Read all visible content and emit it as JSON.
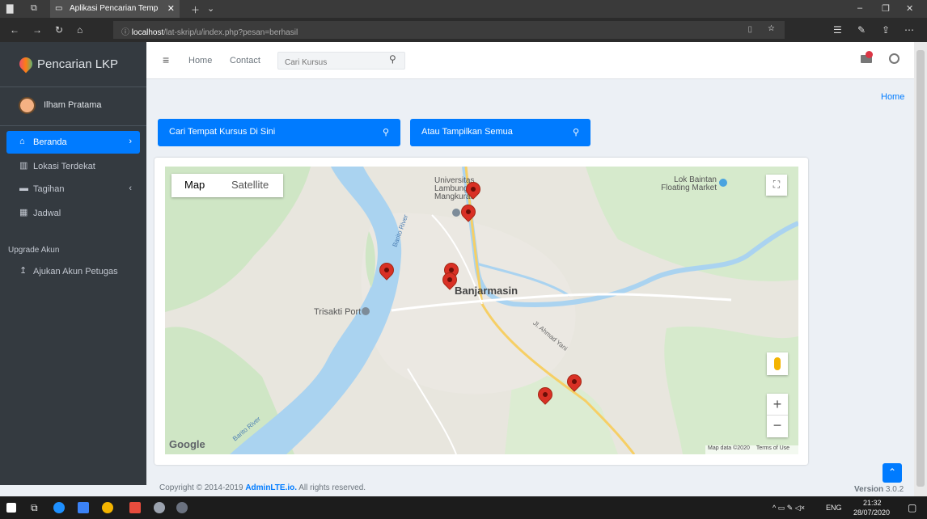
{
  "browser": {
    "tab_title": "Aplikasi Pencarian Temp",
    "url_host": "localhost",
    "url_path": "/lat-skrip/u/index.php?pesan=berhasil"
  },
  "sidebar": {
    "brand": "Pencarian LKP",
    "user_name": "Ilham Pratama",
    "items": [
      {
        "label": "Beranda",
        "icon": "home-icon",
        "active": true
      },
      {
        "label": "Lokasi Terdekat",
        "icon": "map-icon"
      },
      {
        "label": "Tagihan",
        "icon": "bill-icon"
      },
      {
        "label": "Jadwal",
        "icon": "calendar-icon"
      }
    ],
    "section_header": "Upgrade Akun",
    "extra_item": {
      "label": "Ajukan Akun Petugas",
      "icon": "upload-icon"
    }
  },
  "navbar": {
    "home": "Home",
    "contact": "Contact",
    "search_placeholder": "Cari Kursus"
  },
  "breadcrumb": "Home",
  "buttons": {
    "search_course": "Cari Tempat Kursus Di Sini",
    "show_all": "Atau Tampilkan Semua"
  },
  "map": {
    "type_map": "Map",
    "type_satellite": "Satellite",
    "city_label": "Banjarmasin",
    "labels": {
      "university": "Universitas Lambung Mangkurat",
      "floating_market": "Lok Baintan Floating Market",
      "port": "Trisakti Port",
      "river": "Barito River",
      "river2": "Barito River",
      "road": "Jl. Ahmad Yani"
    },
    "google": "Google",
    "attribution": "Map data ©2020",
    "terms": "Terms of Use",
    "marker_count": 7
  },
  "footer": {
    "copyright_prefix": "Copyright © 2014-2019 ",
    "brand": "AdminLTE.io.",
    "suffix": " All rights reserved.",
    "version_label": "Version",
    "version_number": "3.0.2"
  },
  "taskbar": {
    "lang": "ENG",
    "time": "21:32",
    "date": "28/07/2020"
  },
  "colors": {
    "primary": "#007bff",
    "sidebar": "#343a40",
    "marker": "#d93025"
  }
}
